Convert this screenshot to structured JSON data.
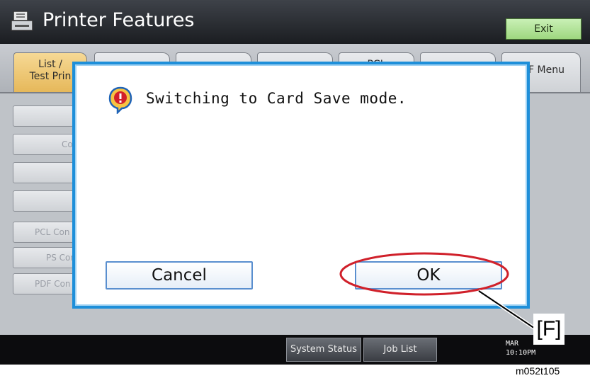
{
  "header": {
    "title": "Printer Features",
    "exit_label": "Exit"
  },
  "tabs": [
    {
      "label": "List /\nTest Prin",
      "active": true
    },
    {
      "label": ""
    },
    {
      "label": ""
    },
    {
      "label": ""
    },
    {
      "label": "PCL"
    },
    {
      "label": ""
    },
    {
      "label": "DF Menu"
    }
  ],
  "side_buttons": [
    "",
    "Co",
    "",
    "",
    "PCL Con",
    "PS Con",
    "PDF Con"
  ],
  "dialog": {
    "message": "Switching to Card Save mode.",
    "cancel_label": "Cancel",
    "ok_label": "OK"
  },
  "bottom": {
    "system_status_label": "System Status",
    "job_list_label": "Job List",
    "month": "MAR",
    "time": "10:10PM"
  },
  "annotation": {
    "callout": "[F]",
    "figure_id": "m052t105"
  },
  "colors": {
    "dialog_border": "#1e8fd9",
    "highlight_ring": "#d0202a",
    "exit_green": "#9ed77f",
    "active_tab": "#e6b85a"
  }
}
